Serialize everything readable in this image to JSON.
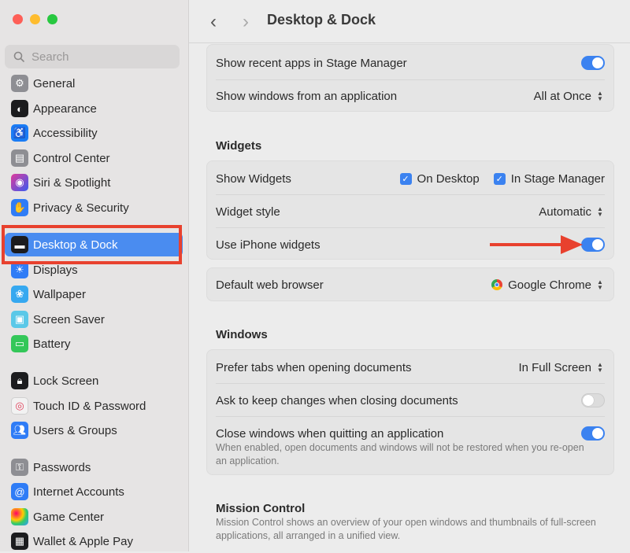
{
  "window": {
    "title": "Desktop & Dock",
    "traffic_colors": [
      "#fe5f57",
      "#febc2e",
      "#28c840"
    ]
  },
  "search": {
    "placeholder": "Search"
  },
  "sidebar": {
    "items": [
      {
        "label": "General",
        "icon": "gear-icon",
        "color": "#8e8e93"
      },
      {
        "label": "Appearance",
        "icon": "appearance-icon",
        "color": "#1c1c1e"
      },
      {
        "label": "Accessibility",
        "icon": "accessibility-icon",
        "color": "#1a7cf5"
      },
      {
        "label": "Control Center",
        "icon": "control-center-icon",
        "color": "#8e8e93"
      },
      {
        "label": "Siri & Spotlight",
        "icon": "siri-icon",
        "color": "#6b3fd6"
      },
      {
        "label": "Privacy & Security",
        "icon": "hand-icon",
        "color": "#2f7cf6"
      },
      {
        "label": "Desktop & Dock",
        "icon": "dock-icon",
        "color": "#1c1c1e"
      },
      {
        "label": "Displays",
        "icon": "sun-icon",
        "color": "#2f7cf6"
      },
      {
        "label": "Wallpaper",
        "icon": "wallpaper-icon",
        "color": "#36a8f0"
      },
      {
        "label": "Screen Saver",
        "icon": "screen-saver-icon",
        "color": "#5ac8e8"
      },
      {
        "label": "Battery",
        "icon": "battery-icon",
        "color": "#34c759"
      },
      {
        "label": "Lock Screen",
        "icon": "lock-icon",
        "color": "#1c1c1e"
      },
      {
        "label": "Touch ID & Password",
        "icon": "fingerprint-icon",
        "color": "#f2f2f2"
      },
      {
        "label": "Users & Groups",
        "icon": "users-icon",
        "color": "#2f7cf6"
      },
      {
        "label": "Passwords",
        "icon": "key-icon",
        "color": "#8e8e93"
      },
      {
        "label": "Internet Accounts",
        "icon": "at-icon",
        "color": "#2f7cf6"
      },
      {
        "label": "Game Center",
        "icon": "game-center-icon",
        "color": "#f2f2f2"
      },
      {
        "label": "Wallet & Apple Pay",
        "icon": "wallet-icon",
        "color": "#1c1c1e"
      }
    ],
    "active": "Desktop & Dock"
  },
  "main": {
    "rows_top": [
      {
        "label": "Show recent apps in Stage Manager",
        "toggle": true
      },
      {
        "label": "Show windows from an application",
        "value": "All at Once"
      }
    ],
    "widgets": {
      "title": "Widgets",
      "show_widgets_label": "Show Widgets",
      "on_desktop": "On Desktop",
      "in_stage_manager": "In Stage Manager",
      "widget_style_label": "Widget style",
      "widget_style_value": "Automatic",
      "iphone_label": "Use iPhone widgets",
      "iphone_toggle": true
    },
    "browser": {
      "label": "Default web browser",
      "value": "Google Chrome"
    },
    "windows": {
      "title": "Windows",
      "prefer_tabs_label": "Prefer tabs when opening documents",
      "prefer_tabs_value": "In Full Screen",
      "ask_keep_label": "Ask to keep changes when closing documents",
      "ask_keep_toggle": false,
      "close_windows_label": "Close windows when quitting an application",
      "close_windows_toggle": true,
      "close_windows_desc": "When enabled, open documents and windows will not be restored when you re-open an application."
    },
    "mission": {
      "title": "Mission Control",
      "desc": "Mission Control shows an overview of your open windows and thumbnails of full-screen applications, all arranged in a unified view."
    }
  },
  "colors": {
    "accent": "#3b82f0",
    "highlight": "#e8412e"
  }
}
